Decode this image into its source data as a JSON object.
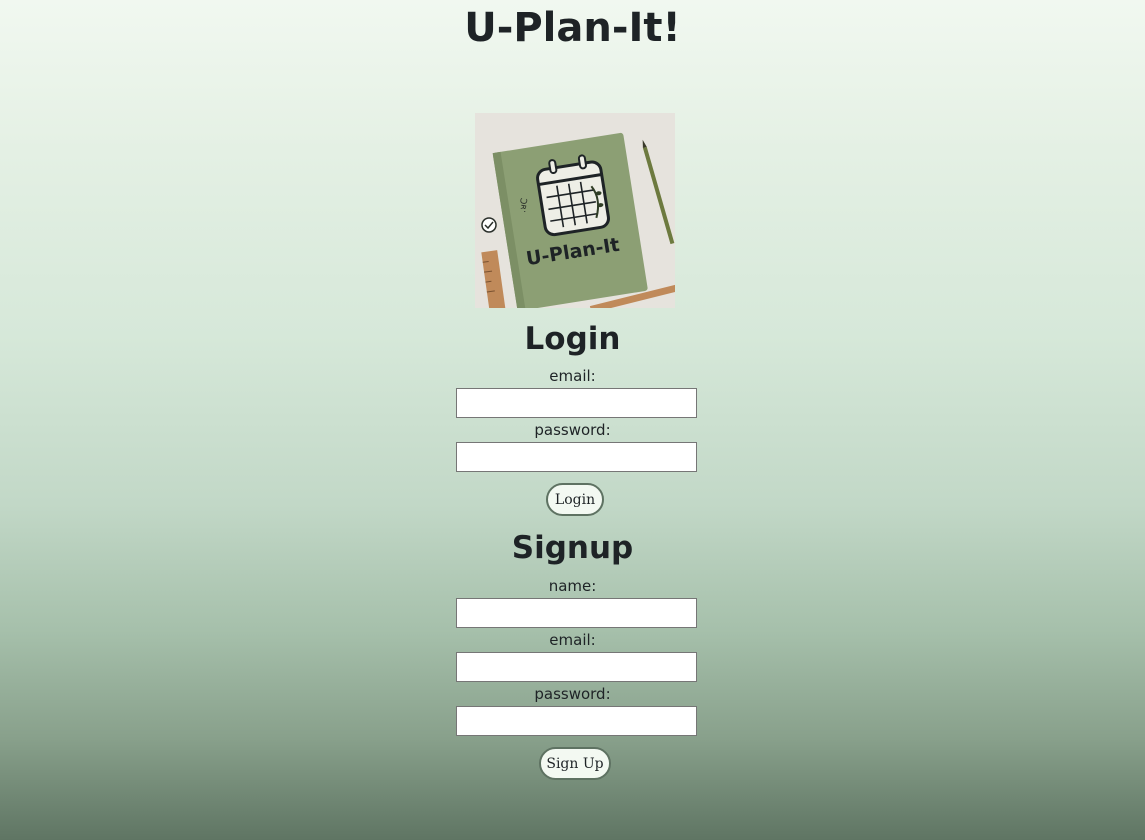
{
  "header": {
    "title": "U-Plan-It!"
  },
  "logo": {
    "text": "U-Plan-It",
    "colors": {
      "notebook": "#8c9f74",
      "background": "#e6e3dd",
      "ruler": "#c08a5a"
    }
  },
  "login": {
    "title": "Login",
    "email_label": "email:",
    "email_value": "",
    "password_label": "password:",
    "password_value": "",
    "button_label": "Login"
  },
  "signup": {
    "title": "Signup",
    "name_label": "name:",
    "name_value": "",
    "email_label": "email:",
    "email_value": "",
    "password_label": "password:",
    "password_value": "",
    "button_label": "Sign Up"
  },
  "theme": {
    "button_border": "#5e7262",
    "button_fill": "#f3f9f2",
    "gradient_top": "#f1f8f0",
    "gradient_bottom": "#5f7563"
  }
}
